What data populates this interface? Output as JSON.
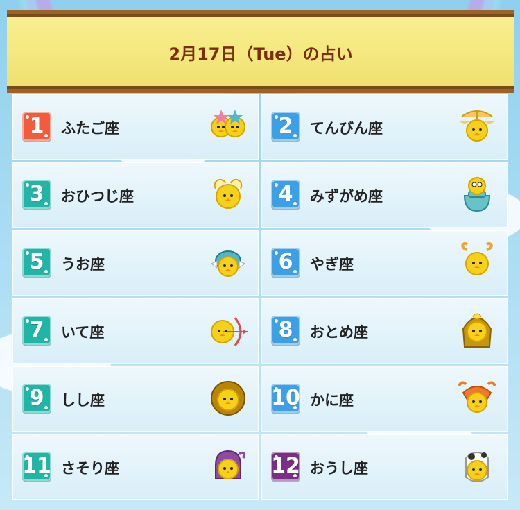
{
  "header": {
    "title": "2月17日（Tue）の占い"
  },
  "rankings": [
    {
      "rank": "1",
      "sign": "ふたご座",
      "icon": "gemini-icon",
      "badge_color": "#f15c3c"
    },
    {
      "rank": "2",
      "sign": "てんびん座",
      "icon": "libra-icon",
      "badge_color": "#3d9fe6"
    },
    {
      "rank": "3",
      "sign": "おひつじ座",
      "icon": "aries-icon",
      "badge_color": "#22b5a6"
    },
    {
      "rank": "4",
      "sign": "みずがめ座",
      "icon": "aquarius-icon",
      "badge_color": "#3d9fe6"
    },
    {
      "rank": "5",
      "sign": "うお座",
      "icon": "pisces-icon",
      "badge_color": "#22b5a6"
    },
    {
      "rank": "6",
      "sign": "やぎ座",
      "icon": "capricorn-icon",
      "badge_color": "#3d9fe6"
    },
    {
      "rank": "7",
      "sign": "いて座",
      "icon": "sagittarius-icon",
      "badge_color": "#22b5a6"
    },
    {
      "rank": "8",
      "sign": "おとめ座",
      "icon": "virgo-icon",
      "badge_color": "#3d9fe6"
    },
    {
      "rank": "9",
      "sign": "しし座",
      "icon": "leo-icon",
      "badge_color": "#22b5a6"
    },
    {
      "rank": "10",
      "sign": "かに座",
      "icon": "cancer-icon",
      "badge_color": "#3d9fe6"
    },
    {
      "rank": "11",
      "sign": "さそり座",
      "icon": "scorpio-icon",
      "badge_color": "#22b5a6"
    },
    {
      "rank": "12",
      "sign": "おうし座",
      "icon": "taurus-icon",
      "badge_color": "#7a2f87"
    }
  ]
}
